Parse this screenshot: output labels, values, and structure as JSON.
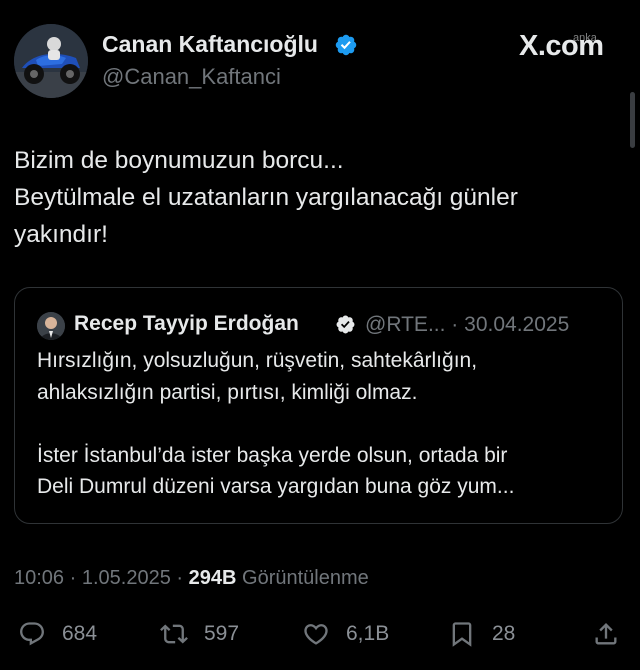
{
  "author": {
    "display_name": "Canan Kaftancıoğlu",
    "handle": "@Canan_Kaftanci",
    "verified": true,
    "avatar_icon": "avatar-motorcycle-photo"
  },
  "brand": {
    "logo_text": "X.com",
    "watermark": "anka"
  },
  "tweet": {
    "lines": [
      "Bizim de boynumuzun borcu...",
      "Beytülmale el uzatanların yargılanacağı günler",
      "yakındır!"
    ]
  },
  "quote": {
    "display_name": "Recep Tayyip Erdoğan",
    "handle": "@RTE...",
    "separator": "·",
    "date": "30.04.2025",
    "verified": true,
    "lines": [
      "Hırsızlığın, yolsuzluğun, rüşvetin, sahtekârlığın,",
      "ahlaksızlığın partisi, pırtısı, kimliği olmaz.",
      "",
      "İster İstanbul’da ister başka yerde olsun, ortada bir",
      "Deli Dumrul düzeni varsa yargıdan buna göz yum..."
    ]
  },
  "meta": {
    "time": "10:06",
    "dot": "·",
    "date": "1.05.2025",
    "views_count": "294B",
    "views_label": "Görüntülenme"
  },
  "actions": {
    "replies": "684",
    "reposts": "597",
    "likes": "6,1B",
    "bookmarks": "28"
  },
  "colors": {
    "background": "#000000",
    "text": "#e7e9ea",
    "muted": "#71767b",
    "verified_blue": "#1d9bf0",
    "border": "#2f3336"
  }
}
